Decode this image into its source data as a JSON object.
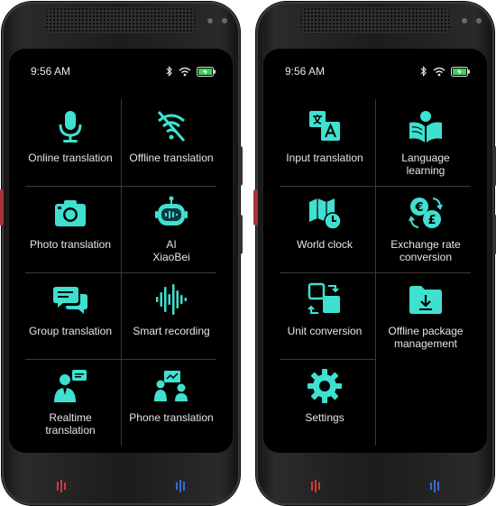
{
  "status": {
    "time": "9:56 AM"
  },
  "colors": {
    "accent": "#3fe0d0",
    "mic_left": "#d23a3a",
    "mic_right": "#3a6ad8"
  },
  "left_screen": {
    "items": [
      {
        "label": "Online translation",
        "icon": "microphone-icon"
      },
      {
        "label": "Offline translation",
        "icon": "offline-icon"
      },
      {
        "label": "Photo translation",
        "icon": "camera-icon"
      },
      {
        "label": "AI\nXiaoBei",
        "icon": "robot-icon"
      },
      {
        "label": "Group translation",
        "icon": "chat-bubbles-icon"
      },
      {
        "label": "Smart recording",
        "icon": "waveform-icon"
      },
      {
        "label": "Realtime\ntranslation",
        "icon": "presenter-icon"
      },
      {
        "label": "Phone translation",
        "icon": "people-meeting-icon"
      }
    ]
  },
  "right_screen": {
    "items": [
      {
        "label": "Input translation",
        "icon": "translate-icon"
      },
      {
        "label": "Language\nlearning",
        "icon": "book-reader-icon"
      },
      {
        "label": "World clock",
        "icon": "map-clock-icon"
      },
      {
        "label": "Exchange rate\nconversion",
        "icon": "currency-exchange-icon"
      },
      {
        "label": "Unit conversion",
        "icon": "unit-convert-icon"
      },
      {
        "label": "Offline package\nmanagement",
        "icon": "download-folder-icon"
      },
      {
        "label": "Settings",
        "icon": "gear-icon"
      }
    ]
  }
}
